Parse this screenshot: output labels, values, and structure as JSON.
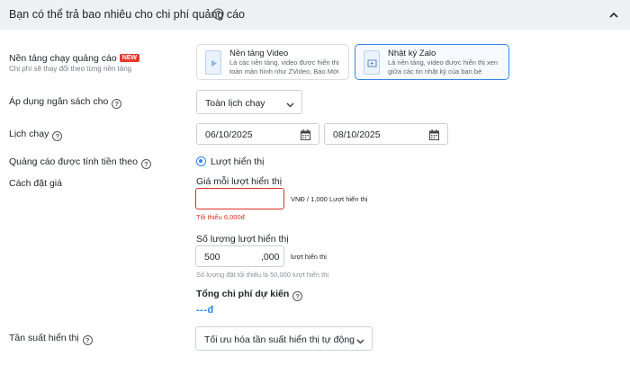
{
  "header": {
    "title": "Bạn có thể trả bao nhiêu cho chi phí quảng cáo"
  },
  "platform": {
    "label": "Nền tảng chạy quảng cáo",
    "badge": "NEW",
    "sublabel": "Chi phí sẽ thay đổi theo từng nền tảng",
    "options": [
      {
        "title": "Nền tảng Video",
        "desc": "Là các nền tảng, video được hiển thị toàn màn hình như ZVideo, Báo Mới",
        "selected": false
      },
      {
        "title": "Nhật ký Zalo",
        "desc": "Là nền tảng, video được hiển thị xen giữa các tin nhật ký của bạn bè",
        "selected": true
      }
    ]
  },
  "budget": {
    "label": "Áp dụng ngân sách cho",
    "value": "Toàn lịch chạy"
  },
  "schedule": {
    "label": "Lịch chạy",
    "start": "06/10/2025",
    "end": "08/10/2025"
  },
  "billing": {
    "label": "Quảng cáo được tính tiền theo",
    "option": "Lượt hiển thị"
  },
  "bid": {
    "label": "Cách đặt giá",
    "price_label": "Giá mỗi lượt hiển thị",
    "price_value": "",
    "price_unit": "VNĐ / 1,000 Lượt hiển thị",
    "price_error": "Tối thiểu 6,000đ",
    "qty_label": "Số lượng lượt hiển thị",
    "qty_value": "500",
    "qty_suffix": ",000",
    "qty_unit": "lượt hiển thị",
    "qty_hint": "Số lượng đặt tối thiểu là 50,000 lượt hiển thị",
    "total_label": "Tổng chi phí dự kiến",
    "total_value": "---đ"
  },
  "frequency": {
    "label": "Tần suất hiển thị",
    "value": "Tối ưu hóa tần suất hiển thị tự động"
  },
  "colors": {
    "accent": "#2f87e9",
    "error": "#d93025",
    "badge": "#e8372c",
    "header_bg": "#eef0f3"
  }
}
